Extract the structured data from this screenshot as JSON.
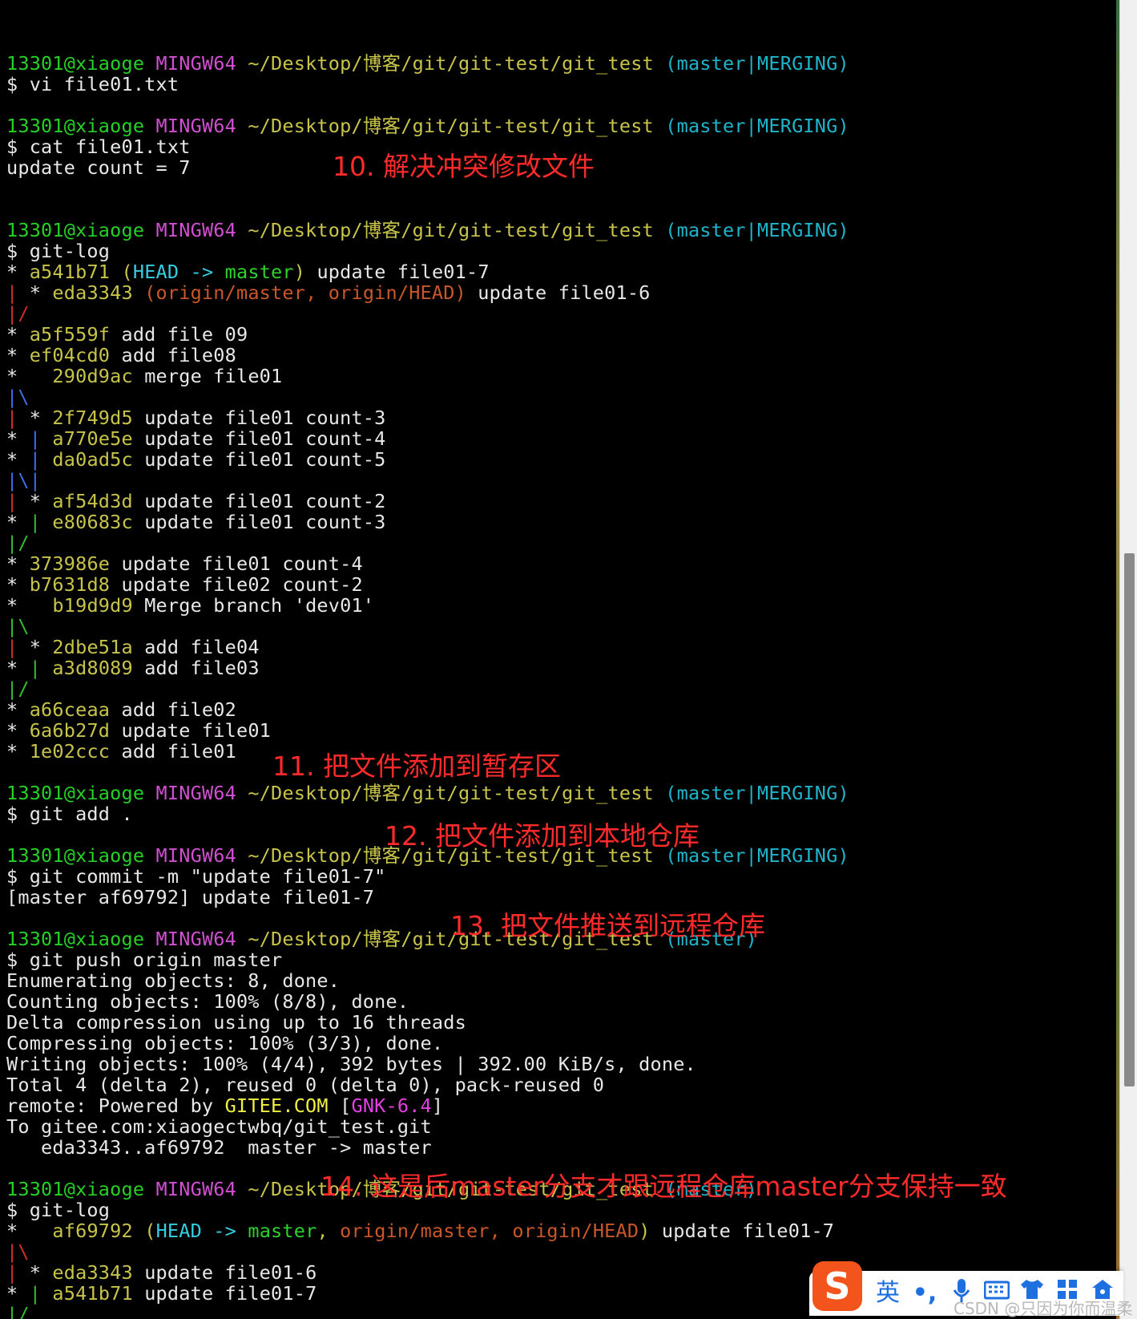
{
  "colors": {
    "user": "#26d126",
    "mingw": "#d14fd1",
    "path": "#c8c44a",
    "branch": "#1fb4c9",
    "text": "#e8e8e8",
    "graph_red": "#d22c2c",
    "graph_green": "#2fbf2f",
    "graph_blue": "#3b6ee8",
    "head": "#34cfe0",
    "master": "#2fd12f",
    "origin": "#c9572a",
    "hash": "#c8c44a",
    "gitee": "#f0f040",
    "gnk": "#e33fe3",
    "annotation": "#ff2a2a"
  },
  "lines": [
    [],
    [
      {
        "t": "13301@xiaoge",
        "c": "user"
      },
      {
        "t": " "
      },
      {
        "t": "MINGW64",
        "c": "mingw"
      },
      {
        "t": " "
      },
      {
        "t": "~/Desktop/博客/git/git-test/git_test",
        "c": "path"
      },
      {
        "t": " "
      },
      {
        "t": "(master|MERGING)",
        "c": "branch"
      }
    ],
    [
      {
        "t": "$ vi file01.txt"
      }
    ],
    [],
    [
      {
        "t": "13301@xiaoge",
        "c": "user"
      },
      {
        "t": " "
      },
      {
        "t": "MINGW64",
        "c": "mingw"
      },
      {
        "t": " "
      },
      {
        "t": "~/Desktop/博客/git/git-test/git_test",
        "c": "path"
      },
      {
        "t": " "
      },
      {
        "t": "(master|MERGING)",
        "c": "branch"
      }
    ],
    [
      {
        "t": "$ cat file01.txt"
      }
    ],
    [
      {
        "t": "update count = 7"
      }
    ],
    [],
    [],
    [
      {
        "t": "13301@xiaoge",
        "c": "user"
      },
      {
        "t": " "
      },
      {
        "t": "MINGW64",
        "c": "mingw"
      },
      {
        "t": " "
      },
      {
        "t": "~/Desktop/博客/git/git-test/git_test",
        "c": "path"
      },
      {
        "t": " "
      },
      {
        "t": "(master|MERGING)",
        "c": "branch"
      }
    ],
    [
      {
        "t": "$ git-log"
      }
    ],
    [
      {
        "t": "* "
      },
      {
        "t": "a541b71",
        "c": "hash"
      },
      {
        "t": " "
      },
      {
        "t": "(",
        "c": "hash"
      },
      {
        "t": "HEAD -> ",
        "c": "head"
      },
      {
        "t": "master",
        "c": "master"
      },
      {
        "t": ")",
        "c": "hash"
      },
      {
        "t": " update file01-7"
      }
    ],
    [
      {
        "t": "|",
        "c": "graph_red"
      },
      {
        "t": " * "
      },
      {
        "t": "eda3343",
        "c": "hash"
      },
      {
        "t": " "
      },
      {
        "t": "(origin/master, origin/HEAD)",
        "c": "origin"
      },
      {
        "t": " update file01-6"
      }
    ],
    [
      {
        "t": "|/",
        "c": "graph_red"
      }
    ],
    [
      {
        "t": "* "
      },
      {
        "t": "a5f559f",
        "c": "hash"
      },
      {
        "t": " add file 09"
      }
    ],
    [
      {
        "t": "* "
      },
      {
        "t": "ef04cd0",
        "c": "hash"
      },
      {
        "t": " add file08"
      }
    ],
    [
      {
        "t": "*   "
      },
      {
        "t": "290d9ac",
        "c": "hash"
      },
      {
        "t": " merge file01"
      }
    ],
    [
      {
        "t": "|\\",
        "c": "graph_blue"
      }
    ],
    [
      {
        "t": "|",
        "c": "graph_red"
      },
      {
        "t": " * "
      },
      {
        "t": "2f749d5",
        "c": "hash"
      },
      {
        "t": " update file01 count-3"
      }
    ],
    [
      {
        "t": "* "
      },
      {
        "t": "|",
        "c": "graph_blue"
      },
      {
        "t": " "
      },
      {
        "t": "a770e5e",
        "c": "hash"
      },
      {
        "t": " update file01 count-4"
      }
    ],
    [
      {
        "t": "* "
      },
      {
        "t": "|",
        "c": "graph_blue"
      },
      {
        "t": " "
      },
      {
        "t": "da0ad5c",
        "c": "hash"
      },
      {
        "t": " update file01 count-5"
      }
    ],
    [
      {
        "t": "|\\|",
        "c": "graph_blue"
      }
    ],
    [
      {
        "t": "|",
        "c": "graph_red"
      },
      {
        "t": " * "
      },
      {
        "t": "af54d3d",
        "c": "hash"
      },
      {
        "t": " update file01 count-2"
      }
    ],
    [
      {
        "t": "* "
      },
      {
        "t": "|",
        "c": "graph_green"
      },
      {
        "t": " "
      },
      {
        "t": "e80683c",
        "c": "hash"
      },
      {
        "t": " update file01 count-3"
      }
    ],
    [
      {
        "t": "|/",
        "c": "graph_green"
      }
    ],
    [
      {
        "t": "* "
      },
      {
        "t": "373986e",
        "c": "hash"
      },
      {
        "t": " update file01 count-4"
      }
    ],
    [
      {
        "t": "* "
      },
      {
        "t": "b7631d8",
        "c": "hash"
      },
      {
        "t": " update file02 count-2"
      }
    ],
    [
      {
        "t": "*   "
      },
      {
        "t": "b19d9d9",
        "c": "hash"
      },
      {
        "t": " Merge branch 'dev01'"
      }
    ],
    [
      {
        "t": "|\\",
        "c": "graph_green"
      }
    ],
    [
      {
        "t": "|",
        "c": "graph_red"
      },
      {
        "t": " * "
      },
      {
        "t": "2dbe51a",
        "c": "hash"
      },
      {
        "t": " add file04"
      }
    ],
    [
      {
        "t": "* "
      },
      {
        "t": "|",
        "c": "graph_green"
      },
      {
        "t": " "
      },
      {
        "t": "a3d8089",
        "c": "hash"
      },
      {
        "t": " add file03"
      }
    ],
    [
      {
        "t": "|/",
        "c": "graph_green"
      }
    ],
    [
      {
        "t": "* "
      },
      {
        "t": "a66ceaa",
        "c": "hash"
      },
      {
        "t": " add file02"
      }
    ],
    [
      {
        "t": "* "
      },
      {
        "t": "6a6b27d",
        "c": "hash"
      },
      {
        "t": " update file01"
      }
    ],
    [
      {
        "t": "* "
      },
      {
        "t": "1e02ccc",
        "c": "hash"
      },
      {
        "t": " add file01"
      }
    ],
    [],
    [
      {
        "t": "13301@xiaoge",
        "c": "user"
      },
      {
        "t": " "
      },
      {
        "t": "MINGW64",
        "c": "mingw"
      },
      {
        "t": " "
      },
      {
        "t": "~/Desktop/博客/git/git-test/git_test",
        "c": "path"
      },
      {
        "t": " "
      },
      {
        "t": "(master|MERGING)",
        "c": "branch"
      }
    ],
    [
      {
        "t": "$ git add ."
      }
    ],
    [],
    [
      {
        "t": "13301@xiaoge",
        "c": "user"
      },
      {
        "t": " "
      },
      {
        "t": "MINGW64",
        "c": "mingw"
      },
      {
        "t": " "
      },
      {
        "t": "~/Desktop/博客/git/git-test/git_test",
        "c": "path"
      },
      {
        "t": " "
      },
      {
        "t": "(master|MERGING)",
        "c": "branch"
      }
    ],
    [
      {
        "t": "$ git commit -m \"update file01-7\""
      }
    ],
    [
      {
        "t": "[master af69792] update file01-7"
      }
    ],
    [],
    [
      {
        "t": "13301@xiaoge",
        "c": "user"
      },
      {
        "t": " "
      },
      {
        "t": "MINGW64",
        "c": "mingw"
      },
      {
        "t": " "
      },
      {
        "t": "~/Desktop/博客/git/git-test/git_test",
        "c": "path"
      },
      {
        "t": " "
      },
      {
        "t": "(master)",
        "c": "branch"
      }
    ],
    [
      {
        "t": "$ git push origin master"
      }
    ],
    [
      {
        "t": "Enumerating objects: 8, done."
      }
    ],
    [
      {
        "t": "Counting objects: 100% (8/8), done."
      }
    ],
    [
      {
        "t": "Delta compression using up to 16 threads"
      }
    ],
    [
      {
        "t": "Compressing objects: 100% (3/3), done."
      }
    ],
    [
      {
        "t": "Writing objects: 100% (4/4), 392 bytes | 392.00 KiB/s, done."
      }
    ],
    [
      {
        "t": "Total 4 (delta 2), reused 0 (delta 0), pack-reused 0"
      }
    ],
    [
      {
        "t": "remote: Powered by "
      },
      {
        "t": "GITEE.COM",
        "c": "gitee"
      },
      {
        "t": " ["
      },
      {
        "t": "GNK-6.4",
        "c": "gnk"
      },
      {
        "t": "]"
      }
    ],
    [
      {
        "t": "To gitee.com:xiaogectwbq/git_test.git"
      }
    ],
    [
      {
        "t": "   eda3343..af69792  master -> master"
      }
    ],
    [],
    [
      {
        "t": "13301@xiaoge",
        "c": "user"
      },
      {
        "t": " "
      },
      {
        "t": "MINGW64",
        "c": "mingw"
      },
      {
        "t": " "
      },
      {
        "t": "~/Desktop/博客/git/git-test/git_test",
        "c": "path"
      },
      {
        "t": " "
      },
      {
        "t": "(master)",
        "c": "branch"
      }
    ],
    [
      {
        "t": "$ git-log"
      }
    ],
    [
      {
        "t": "*   "
      },
      {
        "t": "af69792",
        "c": "hash"
      },
      {
        "t": " "
      },
      {
        "t": "(",
        "c": "hash"
      },
      {
        "t": "HEAD -> ",
        "c": "head"
      },
      {
        "t": "master",
        "c": "master"
      },
      {
        "t": ", ",
        "c": "hash"
      },
      {
        "t": "origin/master, origin/HEAD",
        "c": "origin"
      },
      {
        "t": ")",
        "c": "hash"
      },
      {
        "t": " update file01-7"
      }
    ],
    [
      {
        "t": "|\\",
        "c": "graph_red"
      }
    ],
    [
      {
        "t": "|",
        "c": "graph_red"
      },
      {
        "t": " * "
      },
      {
        "t": "eda3343",
        "c": "hash"
      },
      {
        "t": " update file01-6"
      }
    ],
    [
      {
        "t": "* "
      },
      {
        "t": "|",
        "c": "graph_green"
      },
      {
        "t": " "
      },
      {
        "t": "a541b71",
        "c": "hash"
      },
      {
        "t": " update file01-7"
      }
    ],
    [
      {
        "t": "|/",
        "c": "graph_green"
      }
    ]
  ],
  "annotations": {
    "a10": "10. 解决冲突修改文件",
    "a11": "11. 把文件添加到暂存区",
    "a12": "12. 把文件添加到本地仓库",
    "a13": "13. 把文件推送到远程仓库",
    "a14": "14. 这是后master分支才跟远程仓库master分支保持一致"
  },
  "ime": {
    "logo": "S",
    "lang": "英",
    "punct": "•,",
    "icons": [
      "microphone-icon",
      "keyboard-icon",
      "shirt-icon",
      "grid-icon",
      "toolbox-icon"
    ]
  },
  "watermark": "CSDN @只因为你而温柔"
}
